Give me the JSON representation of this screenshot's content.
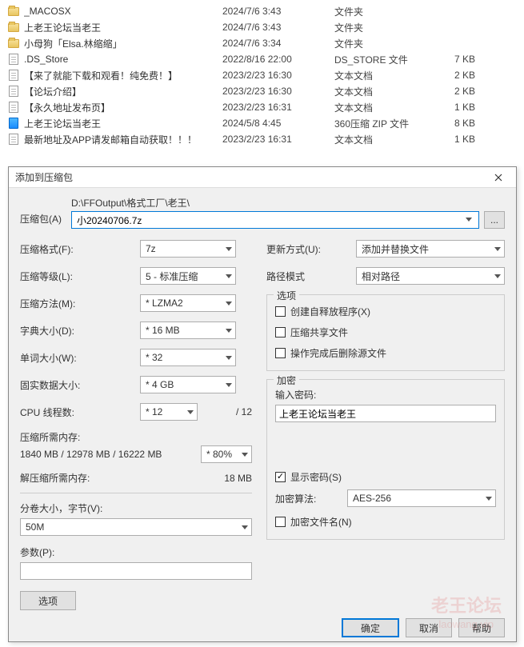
{
  "files": [
    {
      "icon": "folder",
      "name": "_MACOSX",
      "date": "2024/7/6 3:43",
      "type": "文件夹",
      "size": ""
    },
    {
      "icon": "folder",
      "name": "上老王论坛当老王",
      "date": "2024/7/6 3:43",
      "type": "文件夹",
      "size": ""
    },
    {
      "icon": "folder",
      "name": "小母狗「Elsa.林缩缩」",
      "date": "2024/7/6 3:34",
      "type": "文件夹",
      "size": ""
    },
    {
      "icon": "file",
      "name": ".DS_Store",
      "date": "2022/8/16 22:00",
      "type": "DS_STORE 文件",
      "size": "7 KB"
    },
    {
      "icon": "file",
      "name": "【来了就能下载和观看！纯免费！】",
      "date": "2023/2/23 16:30",
      "type": "文本文档",
      "size": "2 KB"
    },
    {
      "icon": "file",
      "name": "【论坛介绍】",
      "date": "2023/2/23 16:30",
      "type": "文本文档",
      "size": "2 KB"
    },
    {
      "icon": "file",
      "name": "【永久地址发布页】",
      "date": "2023/2/23 16:31",
      "type": "文本文档",
      "size": "1 KB"
    },
    {
      "icon": "zip",
      "name": "上老王论坛当老王",
      "date": "2024/5/8 4:45",
      "type": "360压缩 ZIP 文件",
      "size": "8 KB"
    },
    {
      "icon": "file",
      "name": "最新地址及APP请发邮箱自动获取！！！",
      "date": "2023/2/23 16:31",
      "type": "文本文档",
      "size": "1 KB"
    }
  ],
  "dialog": {
    "title": "添加到压缩包",
    "archive_label": "压缩包(A)",
    "archive_dir": "D:\\FFOutput\\格式工厂\\老王\\",
    "archive_name": "小20240706.7z",
    "browse_label": "...",
    "left": {
      "format_label": "压缩格式(F):",
      "format_value": "7z",
      "level_label": "压缩等级(L):",
      "level_value": "5 - 标准压缩",
      "method_label": "压缩方法(M):",
      "method_value": "* LZMA2",
      "dict_label": "字典大小(D):",
      "dict_value": "* 16 MB",
      "word_label": "单词大小(W):",
      "word_value": "* 32",
      "solid_label": "固实数据大小:",
      "solid_value": "* 4 GB",
      "cpu_label": "CPU 线程数:",
      "cpu_value": "* 12",
      "cpu_total": "/ 12",
      "mem_comp_label": "压缩所需内存:",
      "mem_comp_value": "1840 MB / 12978 MB / 16222 MB",
      "mem_comp_pct": "* 80%",
      "mem_decomp_label": "解压缩所需内存:",
      "mem_decomp_value": "18 MB",
      "split_label": "分卷大小，字节(V):",
      "split_value": "50M",
      "params_label": "参数(P):",
      "params_value": "",
      "options_btn": "选项"
    },
    "right": {
      "update_label": "更新方式(U):",
      "update_value": "添加并替换文件",
      "pathmode_label": "路径模式",
      "pathmode_value": "相对路径",
      "options_legend": "选项",
      "opt_sfx": "创建自释放程序(X)",
      "opt_shared": "压缩共享文件",
      "opt_delete": "操作完成后删除源文件",
      "enc_legend": "加密",
      "pwd_label": "输入密码:",
      "pwd_value": "上老王论坛当老王",
      "show_pwd": "显示密码(S)",
      "enc_method_label": "加密算法:",
      "enc_method_value": "AES-256",
      "enc_names": "加密文件名(N)"
    },
    "buttons": {
      "ok": "确定",
      "cancel": "取消",
      "help": "帮助"
    }
  },
  "watermark": {
    "main": "老王论坛",
    "sub": "laowang.vip"
  }
}
